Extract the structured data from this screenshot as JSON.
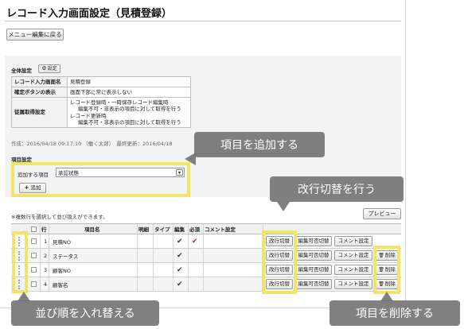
{
  "page": {
    "title": "レコード入力画面設定（見積登録）"
  },
  "toolbar": {
    "menu_back": "メニュー編集に戻る"
  },
  "general": {
    "section": "全体設定",
    "settings_button": "設定",
    "table": [
      {
        "key": "レコード入力画面名",
        "lines": [
          "見積登録"
        ]
      },
      {
        "key": "確定ボタンの表示",
        "lines": [
          "画面下部に常に表示しない"
        ]
      },
      {
        "key": "従属取得設定",
        "lines": [
          "レコード登録時・一時保存レコード編集時",
          "編集不可・非表示の項目に対して取得を行う",
          "レコード更新時",
          "編集不可・非表示の項目に対して取得を行う"
        ]
      }
    ],
    "meta": "作成：2016/04/18 09:17:10 （働く太郎）　最終更新：2016/04/18"
  },
  "items": {
    "section": "項目設定",
    "add_label": "追加する項目",
    "add_select_value": "承認状態",
    "add_button": "追加",
    "note": "※複数行を選択して並び換えができます。",
    "preview_button": "プレビュー",
    "columns": [
      "行",
      "項目名",
      "明細",
      "タイプ",
      "編集",
      "必須",
      "コメント設定"
    ],
    "rows": [
      {
        "no": "1",
        "name": "見積NO",
        "edit": "✔",
        "required": "✔",
        "deletable": false
      },
      {
        "no": "2",
        "name": "ステータス",
        "edit": "✔",
        "required": "",
        "deletable": true
      },
      {
        "no": "3",
        "name": "顧客NO",
        "edit": "✔",
        "required": "",
        "deletable": true
      },
      {
        "no": "4",
        "name": "顧客名",
        "edit": "✔",
        "required": "",
        "deletable": true
      }
    ],
    "row_buttons": {
      "line_break": "改行切替",
      "editable": "編集可否切替",
      "comment": "コメント設定",
      "delete": "削除"
    }
  },
  "callouts": {
    "add_item": "項目を追加する",
    "line_break": "改行切替を行う",
    "reorder": "並び順を入れ替える",
    "delete": "項目を削除する"
  },
  "colors": {
    "highlight": "#f2e36b",
    "callout_bg": "#6e6e6e",
    "required_check": "#d21f1f"
  }
}
